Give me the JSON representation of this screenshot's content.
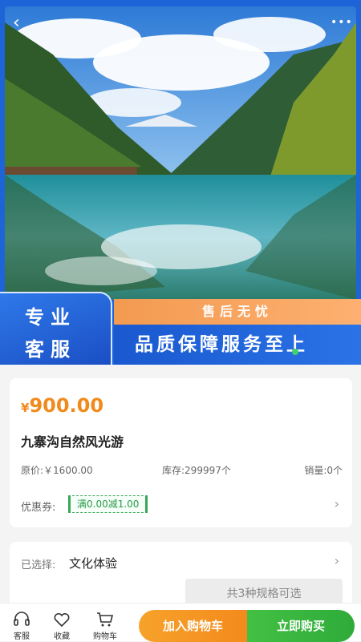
{
  "hero": {
    "icons": {
      "back": "chevron-left-icon",
      "more": "more-dots-icon"
    },
    "banner": {
      "left_line1": "专业",
      "left_line2": "客服",
      "top_strip": "售后无忧",
      "main_strip": "品质保障服务至上"
    },
    "colors": {
      "frame": "#1d64d8",
      "orange": "#f39a51",
      "blue": "#1a58cf"
    }
  },
  "product": {
    "currency": "¥",
    "price": "900.00",
    "title": "九寨沟自然风光游",
    "original_price": "原价:￥1600.00",
    "stock": "库存:299997个",
    "sold": "销量:0个",
    "coupon_label": "优惠券:",
    "coupon": "满0.00减1.00",
    "accent": "#f08a1c"
  },
  "spec": {
    "selected_label": "已选择:",
    "selected_value": "文化体验",
    "available": "共3种规格可选"
  },
  "bottom_bar": {
    "service": "客服",
    "favorite": "收藏",
    "cart": "购物车",
    "add_to_cart": "加入购物车",
    "buy_now": "立即购买"
  }
}
